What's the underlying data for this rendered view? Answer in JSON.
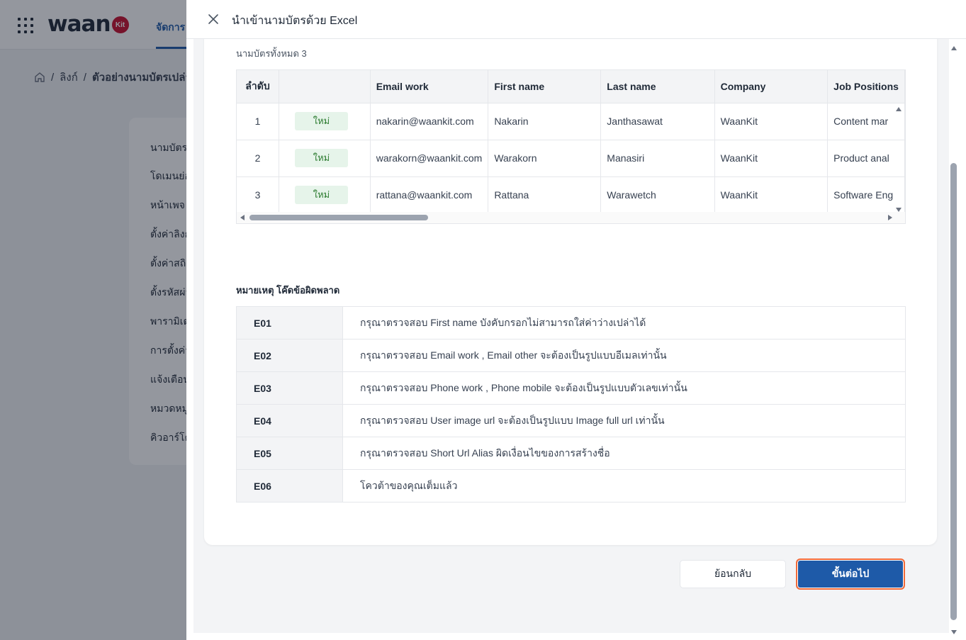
{
  "app": {
    "logo_text": "waan",
    "logo_badge": "Kit",
    "nav_tab": "จัดการ"
  },
  "breadcrumb": {
    "items": [
      "ลิงก์",
      "ตัวอย่างนามบัตรเปล่า"
    ]
  },
  "sidebar": {
    "items": [
      {
        "label": "นามบัตร"
      },
      {
        "label": "โดเมนย่อ"
      },
      {
        "label": "หน้าเพจ"
      },
      {
        "label": "ตั้งค่าลิงก์"
      },
      {
        "label": "ตั้งค่าสถิติ"
      },
      {
        "label": "ตั้งรหัสผ่าน"
      },
      {
        "label": "พารามิเตอร์"
      },
      {
        "label": "การตั้งค่า"
      },
      {
        "label": "แจ้งเตือน"
      },
      {
        "label": "หมวดหมู่"
      },
      {
        "label": "คิวอาร์โค้ด"
      }
    ]
  },
  "drawer": {
    "title": "นำเข้านามบัตรด้วย Excel",
    "total_label": "นามบัตรทั้งหมด 3",
    "table": {
      "headers": [
        "ลำดับ",
        "",
        "Email work",
        "First name",
        "Last name",
        "Company",
        "Job Positions"
      ],
      "rows": [
        {
          "no": "1",
          "status": "ใหม่",
          "email": "nakarin@waankit.com",
          "first": "Nakarin",
          "last": "Janthasawat",
          "company": "WaanKit",
          "job": "Content mar"
        },
        {
          "no": "2",
          "status": "ใหม่",
          "email": "warakorn@waankit.com",
          "first": "Warakorn",
          "last": "Manasiri",
          "company": "WaanKit",
          "job": "Product anal"
        },
        {
          "no": "3",
          "status": "ใหม่",
          "email": "rattana@waankit.com",
          "first": "Rattana",
          "last": "Warawetch",
          "company": "WaanKit",
          "job": "Software Eng"
        }
      ]
    },
    "note_title": "หมายเหตุ โค๊ดข้อผิดพลาด",
    "errors": [
      {
        "code": "E01",
        "desc": "กรุณาตรวจสอบ First name บังคับกรอกไม่สามารถใส่ค่าว่างเปล่าได้"
      },
      {
        "code": "E02",
        "desc": "กรุณาตรวจสอบ Email work , Email other จะต้องเป็นรูปแบบอีเมลเท่านั้น"
      },
      {
        "code": "E03",
        "desc": "กรุณาตรวจสอบ Phone work , Phone mobile จะต้องเป็นรูปแบบตัวเลขเท่านั้น"
      },
      {
        "code": "E04",
        "desc": "กรุณาตรวจสอบ User image url จะต้องเป็นรูปแบบ Image full url เท่านั้น"
      },
      {
        "code": "E05",
        "desc": "กรุณาตรวจสอบ Short Url Alias ผิดเงื่อนไขของการสร้างชื่อ"
      },
      {
        "code": "E06",
        "desc": "โควต้าของคุณเต็มแล้ว"
      }
    ],
    "back_label": "ย้อนกลับ",
    "next_label": "ขั้นต่อไป"
  },
  "colors": {
    "primary": "#1e5aa8",
    "focus_ring": "#f26b3a",
    "badge_bg": "#e6f4ea",
    "badge_text": "#2e7d32"
  }
}
